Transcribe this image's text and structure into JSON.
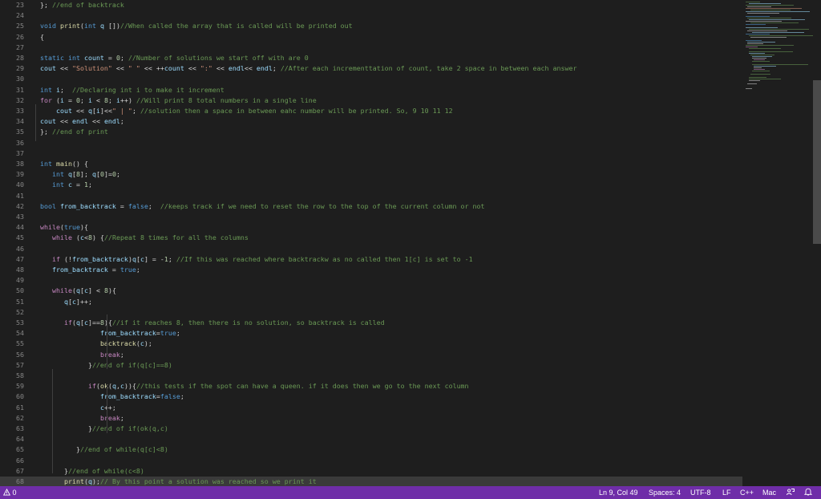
{
  "editor": {
    "current_line_index": 45,
    "lines": [
      {
        "n": "23",
        "segs": [
          [
            "plain",
            "}; "
          ],
          [
            "cmt",
            "//end of backtrack"
          ]
        ]
      },
      {
        "n": "24",
        "segs": []
      },
      {
        "n": "25",
        "segs": [
          [
            "kw",
            "void "
          ],
          [
            "fn",
            "print"
          ],
          [
            "plain",
            "("
          ],
          [
            "kw",
            "int "
          ],
          [
            "var",
            "q "
          ],
          [
            "plain",
            "[])"
          ],
          [
            "cmt",
            "//When called the array that is called will be printed out"
          ]
        ]
      },
      {
        "n": "26",
        "segs": [
          [
            "plain",
            "{"
          ]
        ]
      },
      {
        "n": "27",
        "segs": []
      },
      {
        "n": "28",
        "segs": [
          [
            "kw",
            "static int "
          ],
          [
            "var",
            "count"
          ],
          [
            "plain",
            " = "
          ],
          [
            "num",
            "0"
          ],
          [
            "plain",
            "; "
          ],
          [
            "cmt",
            "//Number of solutions we start off with are 0"
          ]
        ]
      },
      {
        "n": "29",
        "segs": [
          [
            "var",
            "cout"
          ],
          [
            "plain",
            " << "
          ],
          [
            "str",
            "\"Solution\""
          ],
          [
            "plain",
            " << "
          ],
          [
            "str",
            "\" \""
          ],
          [
            "plain",
            " << ++"
          ],
          [
            "var",
            "count"
          ],
          [
            "plain",
            " << "
          ],
          [
            "str",
            "\":\""
          ],
          [
            "plain",
            " << "
          ],
          [
            "var",
            "endl"
          ],
          [
            "plain",
            "<< "
          ],
          [
            "var",
            "endl"
          ],
          [
            "plain",
            "; "
          ],
          [
            "cmt",
            "//After each incrementtation of count, take 2 space in between each answer"
          ]
        ]
      },
      {
        "n": "30",
        "segs": []
      },
      {
        "n": "31",
        "segs": [
          [
            "kw",
            "int "
          ],
          [
            "var",
            "i"
          ],
          [
            "plain",
            ";  "
          ],
          [
            "cmt",
            "//Declaring int i to make it increment"
          ]
        ]
      },
      {
        "n": "32",
        "segs": [
          [
            "ctl",
            "for "
          ],
          [
            "plain",
            "("
          ],
          [
            "var",
            "i"
          ],
          [
            "plain",
            " = "
          ],
          [
            "num",
            "0"
          ],
          [
            "plain",
            "; "
          ],
          [
            "var",
            "i"
          ],
          [
            "plain",
            " < "
          ],
          [
            "num",
            "8"
          ],
          [
            "plain",
            "; "
          ],
          [
            "var",
            "i"
          ],
          [
            "plain",
            "++) "
          ],
          [
            "cmt",
            "//Will print 8 total numbers in a single line"
          ]
        ]
      },
      {
        "n": "33",
        "segs": [
          [
            "plain",
            "    "
          ],
          [
            "var",
            "cout"
          ],
          [
            "plain",
            " << "
          ],
          [
            "var",
            "q"
          ],
          [
            "plain",
            "["
          ],
          [
            "var",
            "i"
          ],
          [
            "plain",
            "]<<"
          ],
          [
            "str",
            "\" | \""
          ],
          [
            "plain",
            "; "
          ],
          [
            "cmt",
            "//solution then a space in between eahc number will be printed. So, 9 10 11 12"
          ]
        ]
      },
      {
        "n": "34",
        "segs": [
          [
            "var",
            "cout"
          ],
          [
            "plain",
            " << "
          ],
          [
            "var",
            "endl"
          ],
          [
            "plain",
            " << "
          ],
          [
            "var",
            "endl"
          ],
          [
            "plain",
            ";"
          ]
        ]
      },
      {
        "n": "35",
        "segs": [
          [
            "plain",
            "}; "
          ],
          [
            "cmt",
            "//end of print"
          ]
        ]
      },
      {
        "n": "36",
        "segs": []
      },
      {
        "n": "37",
        "segs": []
      },
      {
        "n": "38",
        "segs": [
          [
            "kw",
            "int "
          ],
          [
            "fn",
            "main"
          ],
          [
            "plain",
            "() {"
          ]
        ]
      },
      {
        "n": "39",
        "segs": [
          [
            "plain",
            "   "
          ],
          [
            "kw",
            "int "
          ],
          [
            "var",
            "q"
          ],
          [
            "plain",
            "["
          ],
          [
            "num",
            "8"
          ],
          [
            "plain",
            "]; "
          ],
          [
            "var",
            "q"
          ],
          [
            "plain",
            "["
          ],
          [
            "num",
            "0"
          ],
          [
            "plain",
            "]="
          ],
          [
            "num",
            "0"
          ],
          [
            "plain",
            ";"
          ]
        ]
      },
      {
        "n": "40",
        "segs": [
          [
            "plain",
            "   "
          ],
          [
            "kw",
            "int "
          ],
          [
            "var",
            "c"
          ],
          [
            "plain",
            " = "
          ],
          [
            "num",
            "1"
          ],
          [
            "plain",
            ";"
          ]
        ]
      },
      {
        "n": "41",
        "segs": []
      },
      {
        "n": "42",
        "segs": [
          [
            "kw",
            "bool "
          ],
          [
            "var",
            "from_backtrack"
          ],
          [
            "plain",
            " = "
          ],
          [
            "kw",
            "false"
          ],
          [
            "plain",
            ";  "
          ],
          [
            "cmt",
            "//keeps track if we need to reset the row to the top of the current column or not"
          ]
        ]
      },
      {
        "n": "43",
        "segs": []
      },
      {
        "n": "44",
        "segs": [
          [
            "ctl",
            "while"
          ],
          [
            "plain",
            "("
          ],
          [
            "kw",
            "true"
          ],
          [
            "plain",
            "){"
          ]
        ]
      },
      {
        "n": "45",
        "segs": [
          [
            "plain",
            "   "
          ],
          [
            "ctl",
            "while "
          ],
          [
            "plain",
            "("
          ],
          [
            "var",
            "c"
          ],
          [
            "plain",
            "<"
          ],
          [
            "num",
            "8"
          ],
          [
            "plain",
            ") {"
          ],
          [
            "cmt",
            "//Repeat 8 times for all the columns"
          ]
        ]
      },
      {
        "n": "46",
        "segs": []
      },
      {
        "n": "47",
        "segs": [
          [
            "plain",
            "   "
          ],
          [
            "ctl",
            "if "
          ],
          [
            "plain",
            "(!"
          ],
          [
            "var",
            "from_backtrack"
          ],
          [
            "plain",
            ")"
          ],
          [
            "var",
            "q"
          ],
          [
            "plain",
            "["
          ],
          [
            "var",
            "c"
          ],
          [
            "plain",
            "] = -"
          ],
          [
            "num",
            "1"
          ],
          [
            "plain",
            "; "
          ],
          [
            "cmt",
            "//If this was reached where backtrackw as no called then 1[c] is set to -1"
          ]
        ]
      },
      {
        "n": "48",
        "segs": [
          [
            "plain",
            "   "
          ],
          [
            "var",
            "from_backtrack"
          ],
          [
            "plain",
            " = "
          ],
          [
            "kw",
            "true"
          ],
          [
            "plain",
            ";"
          ]
        ]
      },
      {
        "n": "49",
        "segs": []
      },
      {
        "n": "50",
        "segs": [
          [
            "plain",
            "   "
          ],
          [
            "ctl",
            "while"
          ],
          [
            "plain",
            "("
          ],
          [
            "var",
            "q"
          ],
          [
            "plain",
            "["
          ],
          [
            "var",
            "c"
          ],
          [
            "plain",
            "] < "
          ],
          [
            "num",
            "8"
          ],
          [
            "plain",
            "){"
          ]
        ]
      },
      {
        "n": "51",
        "segs": [
          [
            "plain",
            "      "
          ],
          [
            "var",
            "q"
          ],
          [
            "plain",
            "["
          ],
          [
            "var",
            "c"
          ],
          [
            "plain",
            "]++;"
          ]
        ]
      },
      {
        "n": "52",
        "segs": []
      },
      {
        "n": "53",
        "segs": [
          [
            "plain",
            "      "
          ],
          [
            "ctl",
            "if"
          ],
          [
            "plain",
            "("
          ],
          [
            "var",
            "q"
          ],
          [
            "plain",
            "["
          ],
          [
            "var",
            "c"
          ],
          [
            "plain",
            "]=="
          ],
          [
            "num",
            "8"
          ],
          [
            "plain",
            "){"
          ],
          [
            "cmt",
            "//if it reaches 8, then there is no solution, so backtrack is called"
          ]
        ]
      },
      {
        "n": "54",
        "segs": [
          [
            "plain",
            "               "
          ],
          [
            "var",
            "from_backtrack"
          ],
          [
            "plain",
            "="
          ],
          [
            "kw",
            "true"
          ],
          [
            "plain",
            ";"
          ]
        ]
      },
      {
        "n": "55",
        "segs": [
          [
            "plain",
            "               "
          ],
          [
            "fn",
            "backtrack"
          ],
          [
            "plain",
            "("
          ],
          [
            "var",
            "c"
          ],
          [
            "plain",
            ");"
          ]
        ]
      },
      {
        "n": "56",
        "segs": [
          [
            "plain",
            "               "
          ],
          [
            "ctl",
            "break"
          ],
          [
            "plain",
            ";"
          ]
        ]
      },
      {
        "n": "57",
        "segs": [
          [
            "plain",
            "            }"
          ],
          [
            "cmt",
            "//end of if(q[c]==8)"
          ]
        ]
      },
      {
        "n": "58",
        "segs": []
      },
      {
        "n": "59",
        "segs": [
          [
            "plain",
            "            "
          ],
          [
            "ctl",
            "if"
          ],
          [
            "plain",
            "("
          ],
          [
            "fn",
            "ok"
          ],
          [
            "plain",
            "("
          ],
          [
            "var",
            "q"
          ],
          [
            "plain",
            ","
          ],
          [
            "var",
            "c"
          ],
          [
            "plain",
            "))"
          ],
          [
            "plain",
            "{"
          ],
          [
            "cmt",
            "//this tests if the spot can have a queen. if it does then we go to the next column"
          ]
        ]
      },
      {
        "n": "60",
        "segs": [
          [
            "plain",
            "               "
          ],
          [
            "var",
            "from_backtrack"
          ],
          [
            "plain",
            "="
          ],
          [
            "kw",
            "false"
          ],
          [
            "plain",
            ";"
          ]
        ]
      },
      {
        "n": "61",
        "segs": [
          [
            "plain",
            "               "
          ],
          [
            "var",
            "c"
          ],
          [
            "plain",
            "++;"
          ]
        ]
      },
      {
        "n": "62",
        "segs": [
          [
            "plain",
            "               "
          ],
          [
            "ctl",
            "break"
          ],
          [
            "plain",
            ";"
          ]
        ]
      },
      {
        "n": "63",
        "segs": [
          [
            "plain",
            "            }"
          ],
          [
            "cmt",
            "//end of if(ok(q,c)"
          ]
        ]
      },
      {
        "n": "64",
        "segs": []
      },
      {
        "n": "65",
        "segs": [
          [
            "plain",
            "         }"
          ],
          [
            "cmt",
            "//end of while(q[c]<8)"
          ]
        ]
      },
      {
        "n": "66",
        "segs": []
      },
      {
        "n": "67",
        "segs": [
          [
            "plain",
            "      }"
          ],
          [
            "cmt",
            "//end of while(c<8)"
          ]
        ]
      },
      {
        "n": "68",
        "segs": [
          [
            "plain",
            "      "
          ],
          [
            "fn",
            "print"
          ],
          [
            "plain",
            "("
          ],
          [
            "var",
            "q"
          ],
          [
            "plain",
            ");"
          ],
          [
            "cmt",
            "// By this point a solution was reached so we print it"
          ]
        ]
      }
    ]
  },
  "status": {
    "problems": "0",
    "position": "Ln 9, Col 49",
    "spaces": "Spaces: 4",
    "encoding": "UTF-8",
    "eol": "LF",
    "language": "C++",
    "platform": "Mac",
    "icons": [
      "warning-icon",
      "feedback-icon",
      "bell-icon"
    ]
  },
  "colors": {
    "background": "#1e1e1e",
    "statusbar": "#6f2da8",
    "line_number": "#858585",
    "keyword": "#569cd6",
    "control": "#c586c0",
    "string": "#ce9178",
    "number": "#b5cea8",
    "comment": "#6a9955",
    "function": "#dcdcaa",
    "variable": "#9cdcfe"
  }
}
